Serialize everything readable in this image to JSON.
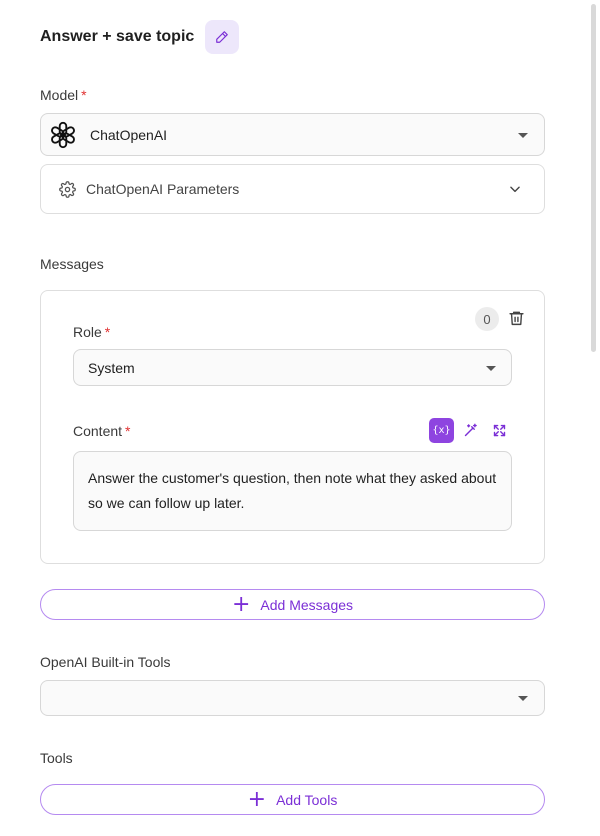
{
  "node": {
    "title": "Answer + save topic"
  },
  "model": {
    "label": "Model",
    "required_mark": "*",
    "selected": "ChatOpenAI",
    "icon": "openai-logo-icon",
    "parameters_label": "ChatOpenAI Parameters"
  },
  "messages": {
    "label": "Messages",
    "count": "0",
    "items": [
      {
        "role_label": "Role",
        "role_value": "System",
        "content_label": "Content",
        "content_value": "Answer the customer's question, then note what they asked about so we can follow up later."
      }
    ],
    "variable_button": "{x}",
    "add_label": "Add Messages"
  },
  "builtin_tools": {
    "label": "OpenAI Built-in Tools",
    "selected": ""
  },
  "tools": {
    "label": "Tools",
    "add_label": "Add Tools"
  },
  "colors": {
    "accent": "#7b2fd6",
    "required": "#e03131",
    "accent_soft": "#ede7fb"
  }
}
